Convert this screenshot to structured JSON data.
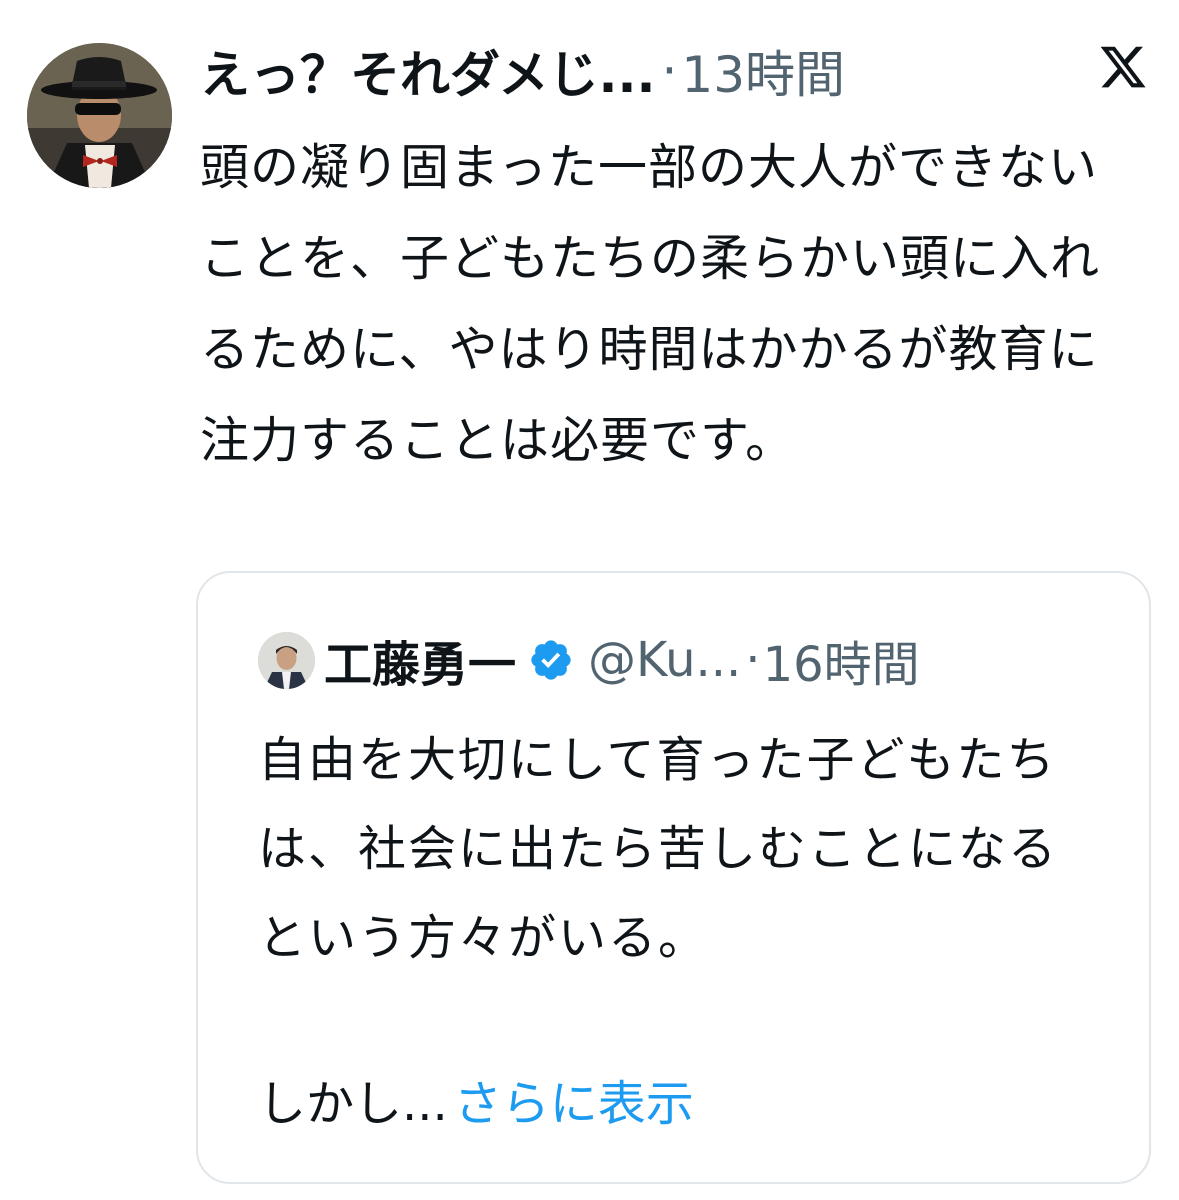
{
  "tweet": {
    "display_name": "えっ？それダメじ...",
    "separator": "·",
    "timestamp": "13時間",
    "logo_icon": "x-logo-icon",
    "avatar_icon": "masked-man-avatar",
    "text": "頭の凝り固まった一部の大人ができないことを、子どもたちの柔らかい頭に入れるために、やはり時間はかかるが教育に注力することは必要です。"
  },
  "quote": {
    "display_name": "工藤勇一",
    "verified_icon": "verified-badge-icon",
    "handle": "@Ku...",
    "separator": "·",
    "timestamp": "16時間",
    "avatar_icon": "man-in-suit-avatar",
    "text": "自由を大切にして育った子どもたちは、社会に出たら苦しむことになるという方々がいる。",
    "last_line": "しかし...",
    "show_more": "さらに表示"
  },
  "colors": {
    "text_primary": "#0f1419",
    "text_secondary": "#536471",
    "link": "#1d9bf0",
    "verified": "#1d9bf0",
    "card_border": "#e1e6ea"
  }
}
